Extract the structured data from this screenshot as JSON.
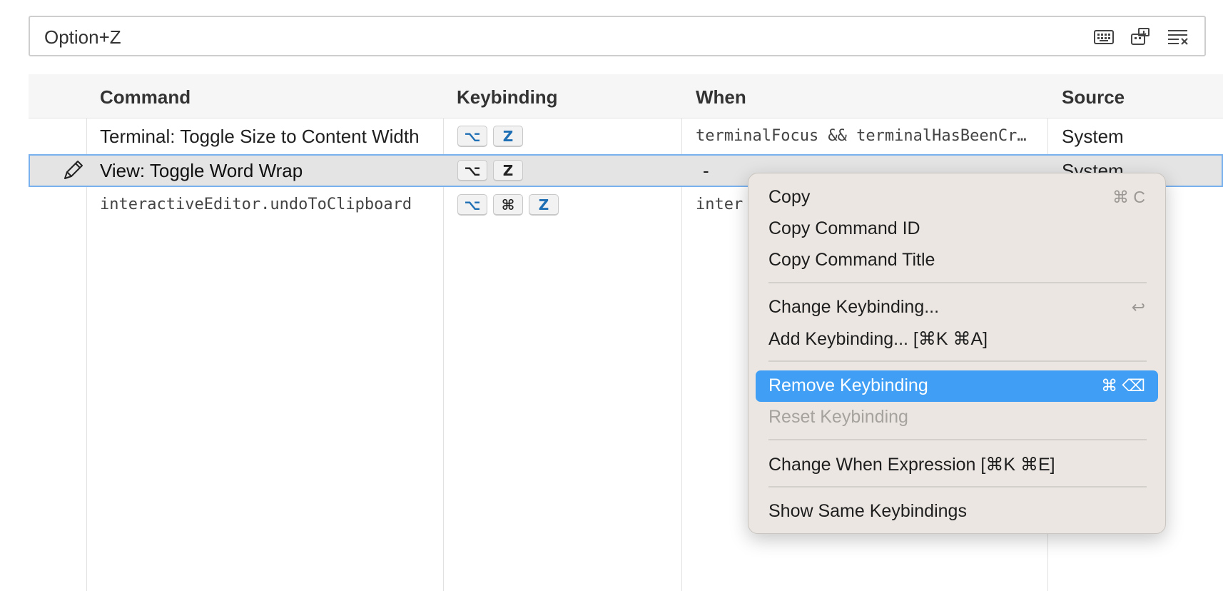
{
  "search": {
    "value": "Option+Z",
    "actions": [
      {
        "icon": "keyboard-icon"
      },
      {
        "icon": "record-keys-icon"
      },
      {
        "icon": "clear-icon"
      }
    ]
  },
  "table": {
    "columns": {
      "command": "Command",
      "keybinding": "Keybinding",
      "when": "When",
      "source": "Source"
    },
    "rows": [
      {
        "command": "Terminal: Toggle Size to Content Width",
        "keys": [
          "⌥",
          "Z"
        ],
        "when": "terminalFocus && terminalHasBeenCr…",
        "source": "System"
      },
      {
        "command": "View: Toggle Word Wrap",
        "keys": [
          "⌥",
          "Z"
        ],
        "when": "-",
        "source": "System",
        "selected": true,
        "edit_icon": "pencil-icon"
      },
      {
        "command": "interactiveEditor.undoToClipboard",
        "keys": [
          "⌥",
          "⌘",
          "Z"
        ],
        "when": "inter",
        "source": ""
      }
    ]
  },
  "context_menu": {
    "items": [
      {
        "label": "Copy",
        "shortcut": "⌘ C"
      },
      {
        "label": "Copy Command ID",
        "shortcut": ""
      },
      {
        "label": "Copy Command Title",
        "shortcut": ""
      },
      {
        "label": "Change Keybinding...",
        "shortcut": "↩"
      },
      {
        "label": "Add Keybinding... [⌘K ⌘A]",
        "shortcut": ""
      },
      {
        "label": "Remove Keybinding",
        "shortcut": "⌘ ⌫",
        "active": true
      },
      {
        "label": "Reset Keybinding",
        "shortcut": "",
        "disabled": true
      },
      {
        "label": "Change When Expression [⌘K ⌘E]",
        "shortcut": ""
      },
      {
        "label": "Show Same Keybindings",
        "shortcut": ""
      }
    ]
  },
  "colors": {
    "accent": "#409ff5",
    "selection_border": "#79b1ee",
    "key_blue": "#1f6fb5"
  }
}
